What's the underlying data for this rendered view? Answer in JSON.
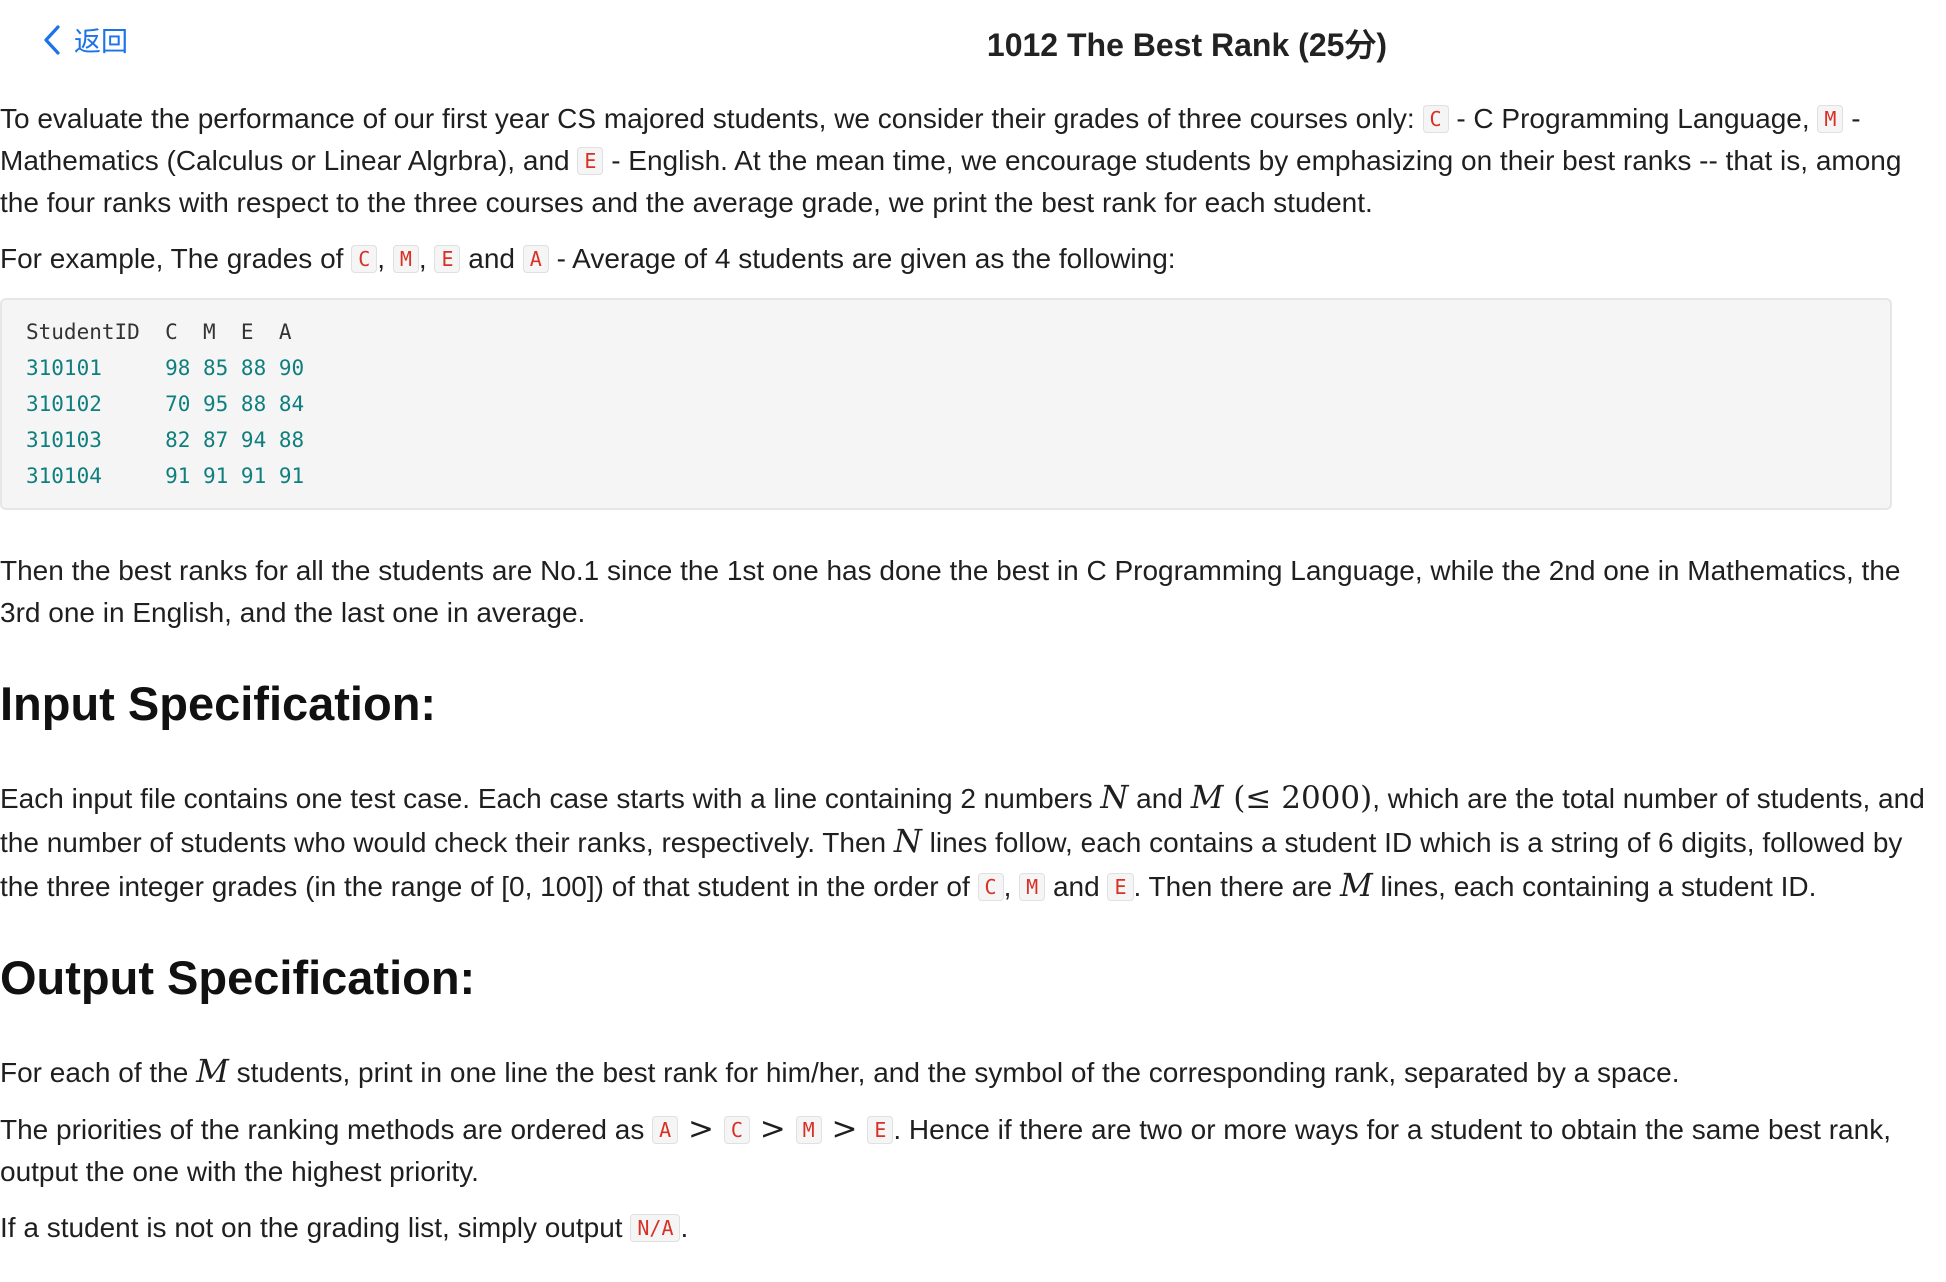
{
  "header": {
    "back_label": "返回",
    "title": "1012 The Best Rank (25分)"
  },
  "intro": {
    "p1_a": "To evaluate the performance of our first year CS majored students, we consider their grades of three courses only: ",
    "code_C": "C",
    "p1_b": " - C Programming Language, ",
    "code_M": "M",
    "p1_c": " - Mathematics (Calculus or Linear Algrbra), and ",
    "code_E": "E",
    "p1_d": " - English. At the mean time, we encourage students by emphasizing on their best ranks -- that is, among the four ranks with respect to the three courses and the average grade, we print the best rank for each student.",
    "p2_a": "For example, The grades of ",
    "p2_sep1": ", ",
    "p2_sep2": ", ",
    "p2_and": " and ",
    "code_A": "A",
    "p2_b": " - Average of 4 students are given as the following:"
  },
  "table": {
    "header": "StudentID  C  M  E  A",
    "rows": [
      "310101     98 85 88 90",
      "310102     70 95 88 84",
      "310103     82 87 94 88",
      "310104     91 91 91 91"
    ]
  },
  "after_table": "Then the best ranks for all the students are No.1 since the 1st one has done the best in C Programming Language, while the 2nd one in Mathematics, the 3rd one in English, and the last one in average.",
  "input_spec": {
    "heading": "Input Specification:",
    "t1": "Each input file contains one test case. Each case starts with a line containing 2 numbers ",
    "N": "N",
    "and": " and ",
    "M": "M",
    "le": " (≤ 2000)",
    "t2": ", which are the total number of students, and the number of students who would check their ranks, respectively. Then ",
    "t3": " lines follow, each contains a student ID which is a string of 6 digits, followed by the three integer grades (in the range of [0, 100]) of that student in the order of ",
    "comma": ", ",
    "and2": " and ",
    "t4": ". Then there are ",
    "t5": " lines, each containing a student ID."
  },
  "output_spec": {
    "heading": "Output Specification:",
    "p1_a": "For each of the ",
    "p1_b": " students, print in one line the best rank for him/her, and the symbol of the corresponding rank, separated by a space.",
    "p2_a": "The priorities of the ranking methods are ordered as ",
    "gt": " > ",
    "p2_b": ". Hence if there are two or more ways for a student to obtain the same best rank, output the one with the highest priority.",
    "p3_a": "If a student is not on the grading list, simply output ",
    "code_NA": "N/A",
    "p3_b": "."
  }
}
